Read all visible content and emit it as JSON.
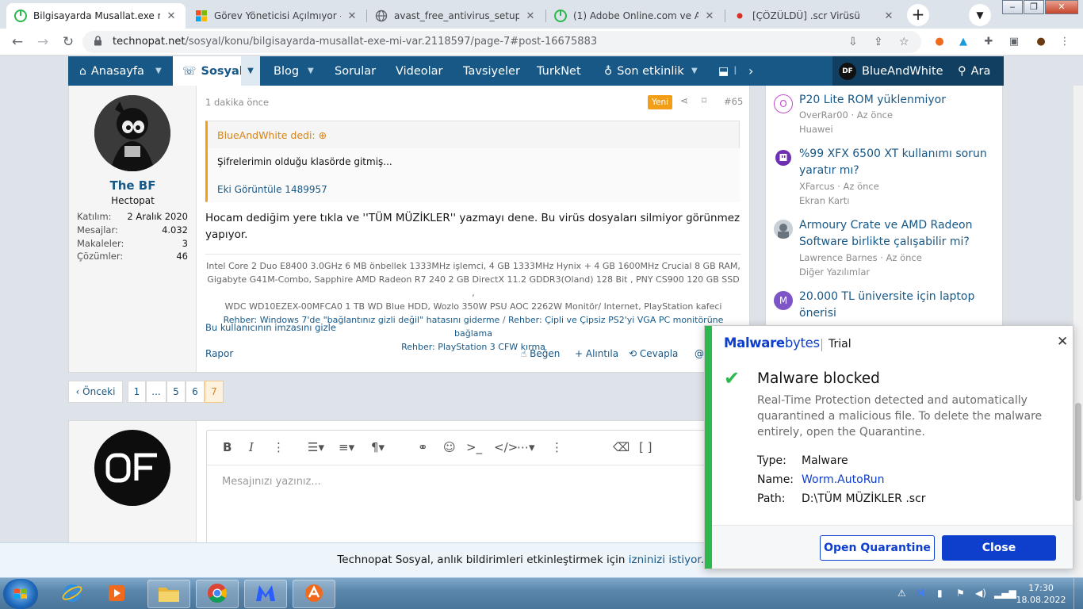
{
  "colors": {
    "brand_blue": "#185886",
    "accent_orange": "#f29e16",
    "mb_blue": "#0d3ecc",
    "mb_green": "#2db84d"
  },
  "browser": {
    "tabs": [
      {
        "title": "Bilgisayarda Musallat.exe mi var?",
        "active": true,
        "icon": "technopat-icon"
      },
      {
        "title": "Görev Yöneticisi Açılmıyor - Micr",
        "active": false,
        "icon": "windows-icon"
      },
      {
        "title": "avast_free_antivirus_setup_onlin",
        "active": false,
        "icon": "globe-icon"
      },
      {
        "title": "(1) Adobe Online.com ve Adobe",
        "active": false,
        "icon": "technopat-icon"
      },
      {
        "title": "[ÇÖZÜLDÜ] .scr Virüsü",
        "active": false,
        "icon": "red-dot-icon"
      }
    ],
    "close_glyph": "✕",
    "new_tab_glyph": "+",
    "url_host": "technopat.net",
    "url_path": "/sosyal/konu/bilgisayarda-musallat-exe-mi-var.2118597/page-7#post-16675883"
  },
  "nav": {
    "items": [
      {
        "label": "Anasayfa",
        "icon": "home-icon",
        "caret": true
      },
      {
        "label": "Sosyal",
        "icon": "chat-icon",
        "caret": true,
        "selected": true
      },
      {
        "label": "Blog",
        "caret": true
      },
      {
        "label": "Sorular"
      },
      {
        "label": "Videolar"
      },
      {
        "label": "Tavsiyeler"
      },
      {
        "label": "TurkNet"
      },
      {
        "label": "Son etkinlik",
        "icon": "bulb-icon",
        "caret": true
      },
      {
        "label": "I",
        "icon": "inbox-icon"
      }
    ],
    "username": "BlueAndWhite",
    "avatar_text": "DF",
    "search_label": "Ara"
  },
  "post": {
    "time": "1 dakika önce",
    "badge": "Yeni",
    "number": "#65",
    "author": {
      "name": "The BF",
      "title": "Hectopat",
      "stats": [
        {
          "label": "Katılım:",
          "value": "2 Aralık 2020"
        },
        {
          "label": "Mesajlar:",
          "value": "4.032"
        },
        {
          "label": "Makaleler:",
          "value": "3"
        },
        {
          "label": "Çözümler:",
          "value": "46"
        }
      ]
    },
    "quote": {
      "author": "BlueAndWhite dedi:",
      "text": "Şifrelerimin olduğu klasörde gitmiş...",
      "attachment": "Eki Görüntüle 1489957"
    },
    "body": "Hocam dediğim yere tıkla ve ''TÜM MÜZİKLER'' yazmayı dene. Bu virüs dosyaları silmiyor görünmez yapıyor.",
    "signature": {
      "line1": "Intel Core 2 Duo E8400 3.0GHz 6 MB önbellek 1333MHz işlemci, 4 GB 1333MHz Hynix + 4 GB 1600MHz Crucial 8 GB RAM,",
      "line2": "Gigabyte G41M-Combo, Sapphire AMD Radeon R7 240 2 GB DirectX 11.2 GDDR3(Oland) 128 Bit , PNY CS900 120 GB SSD ,",
      "line3": "WDC WD10EZEX-00MFCA0 1 TB WD Blue HDD, Wozlo 350W PSU AOC 2262W Monitör/ Internet, PlayStation kafeci",
      "link1": "Rehber: Windows 7'de \"bağlantınız gizli değil\" hatasını giderme",
      "sep": " / ",
      "link2": "Rehber: Çipli ve Çipsiz PS2'yi VGA PC monitörüne bağlama",
      "link3": "Rehber: PlayStation 3 CFW kırma"
    },
    "hide_signature": "Bu kullanıcının imzasını gizle",
    "report": "Rapor",
    "like": "Beğen",
    "quote_action": "+ Alıntıla",
    "reply": "Cevapla",
    "more": "@"
  },
  "pagination": {
    "prev": "‹ Önceki",
    "pages": [
      "1",
      "...",
      "5",
      "6",
      "7"
    ],
    "current": "7"
  },
  "editor": {
    "placeholder": "Mesajınızı yazınız..."
  },
  "sidebar": {
    "items": [
      {
        "title": "P20 Lite ROM yüklenmiyor",
        "meta": "OverRar00 · Az önce",
        "forum": "Huawei",
        "avatar_letter": "O",
        "avatar_color": "#c44dd1"
      },
      {
        "title": "%99 XFX 6500 XT kullanımı sorun yaratır mı?",
        "meta": "XFarcus · Az önce",
        "forum": "Ekran Kartı",
        "avatar_letter": "",
        "avatar_color": "#6e2fb3"
      },
      {
        "title": "Armoury Crate ve AMD Radeon Software birlikte çalışabilir mi?",
        "meta": "Lawrence Barnes · Az önce",
        "forum": "Diğer Yazılımlar",
        "avatar_letter": "",
        "avatar_color": "#9aa7b3"
      },
      {
        "title": "20.000 TL üniversite için laptop önerisi",
        "meta": "",
        "forum": "",
        "avatar_letter": "M",
        "avatar_color": "#7d55c7"
      }
    ]
  },
  "notification": {
    "text": "Technopat Sosyal, anlık bildirimleri etkinleştirmek için ",
    "link": "izninizi istiyor."
  },
  "malwarebytes": {
    "brand_bold": "Malware",
    "brand_light": "bytes",
    "edition": "Trial",
    "title": "Malware blocked",
    "description": "Real-Time Protection detected and automatically quarantined a malicious file. To delete the malware entirely, open the Quarantine.",
    "type_label": "Type:",
    "type_value": "Malware",
    "name_label": "Name:",
    "name_value": "Worm.AutoRun",
    "path_label": "Path:",
    "path_value": "D:\\TÜM MÜZİKLER .scr",
    "open_button": "Open Quarantine",
    "close_button": "Close"
  },
  "taskbar": {
    "time": "17:30",
    "date": "18.08.2022"
  }
}
